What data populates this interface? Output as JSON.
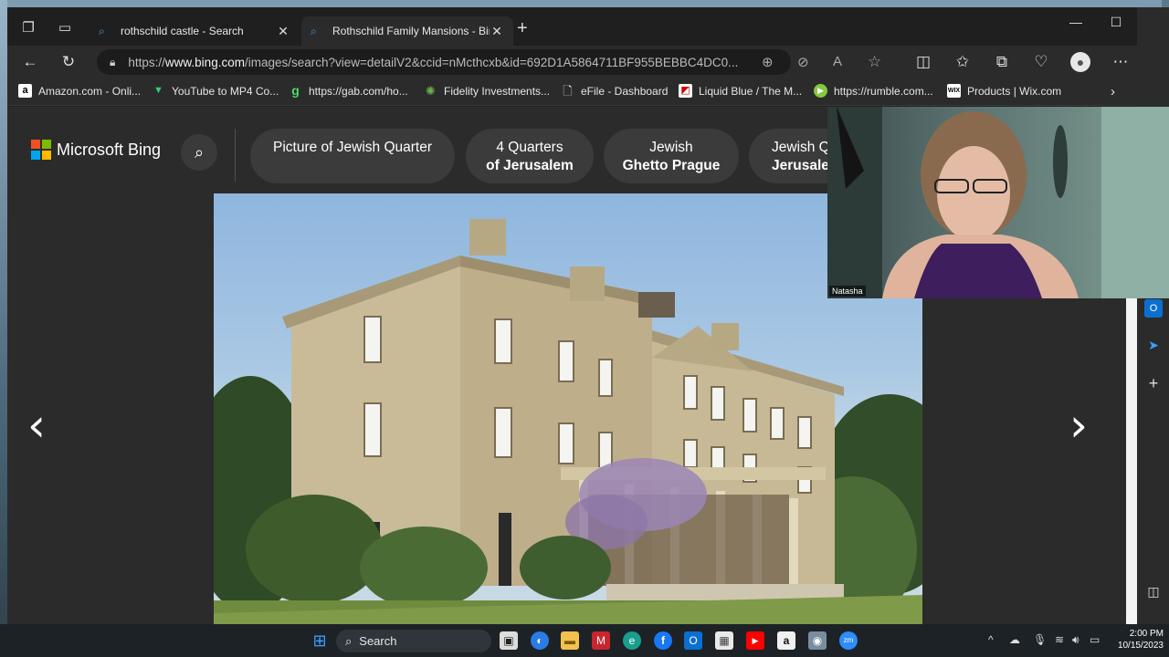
{
  "tabs": [
    {
      "title": "rothschild castle - Search",
      "active": false
    },
    {
      "title": "Rothschild Family Mansions - Bing",
      "active": true
    }
  ],
  "address": {
    "prefix": "https://",
    "host": "www.bing.com",
    "path": "/images/search?view=detailV2&ccid=nMcthcxb&id=692D1A5864711BF955BEBBC4DC0..."
  },
  "bookmarks": [
    {
      "label": "Amazon.com - Onli...",
      "icon": "amazon-icon",
      "color": "#ffffff"
    },
    {
      "label": "YouTube to MP4 Co...",
      "icon": "download-icon",
      "color": "#2ecc71"
    },
    {
      "label": "https://gab.com/ho...",
      "icon": "gab-icon",
      "color": "#4cd964"
    },
    {
      "label": "Fidelity Investments...",
      "icon": "fidelity-icon",
      "color": "#6ab04c"
    },
    {
      "label": "eFile - Dashboard",
      "icon": "document-icon",
      "color": "#dddddd"
    },
    {
      "label": "Liquid Blue / The M...",
      "icon": "liquid-blue-icon",
      "color": "#ffffff"
    },
    {
      "label": "https://rumble.com...",
      "icon": "rumble-icon",
      "color": "#85c742"
    },
    {
      "label": "Products | Wix.com",
      "icon": "wix-icon",
      "color": "#ffffff"
    }
  ],
  "bing": {
    "brand": "Microsoft Bing",
    "chips": [
      {
        "line1": "Picture of Jewish Quarter",
        "line2": ""
      },
      {
        "line1": "4 Quarters",
        "line2": "of Jerusalem"
      },
      {
        "line1": "Jewish",
        "line2": "Ghetto Prague"
      },
      {
        "line1": "Jewish Q",
        "line2": "Jerusale"
      }
    ]
  },
  "webcam": {
    "name": "Natasha"
  },
  "taskbar": {
    "search_label": "Search",
    "time": "2:00 PM",
    "date": "10/15/2023"
  },
  "colors": {
    "accent": "#4a9fe8",
    "ms_red": "#f25022",
    "ms_green": "#7fba00",
    "ms_blue": "#00a4ef",
    "ms_yellow": "#ffb900"
  }
}
